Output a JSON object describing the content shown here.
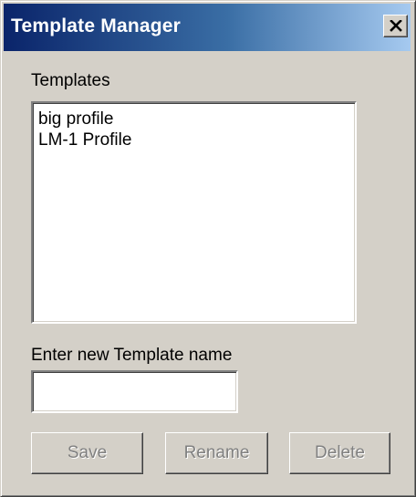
{
  "window": {
    "title": "Template Manager"
  },
  "templates": {
    "label": "Templates",
    "items": [
      {
        "label": "big profile"
      },
      {
        "label": "LM-1 Profile"
      }
    ]
  },
  "new_name": {
    "label": "Enter new Template name",
    "value": "",
    "placeholder": ""
  },
  "buttons": {
    "save": "Save",
    "rename": "Rename",
    "delete": "Delete",
    "state": "disabled"
  },
  "icons": {
    "close": "close-icon"
  },
  "colors": {
    "titlebar_start": "#0a246a",
    "titlebar_end": "#a6caf0",
    "face": "#d4d0c8",
    "disabled_text": "#808080"
  }
}
